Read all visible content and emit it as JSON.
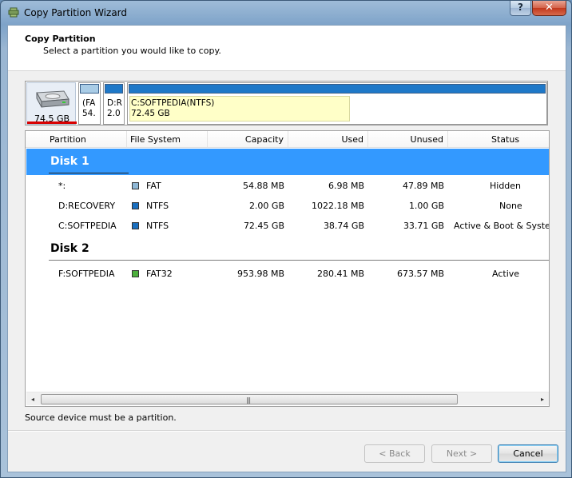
{
  "window": {
    "title": "Copy Partition Wizard",
    "close_glyph": "✕",
    "help_glyph": "?"
  },
  "header": {
    "title": "Copy Partition",
    "subtitle": "Select a partition you would like to copy."
  },
  "disk_map": {
    "disk_size": "74.5 GB",
    "blocks": [
      {
        "line1": "(FA",
        "line2": "54.",
        "bar_color": "#a9cce6"
      },
      {
        "line1": "D:R",
        "line2": "2.0",
        "bar_color": "#1e78c8"
      },
      {
        "line1": "C:SOFTPEDIA(NTFS)",
        "line2": "72.45 GB",
        "bar_color": "#1e78c8"
      }
    ]
  },
  "list": {
    "columns": [
      "Partition",
      "File System",
      "Capacity",
      "Used",
      "Unused",
      "Status"
    ],
    "disks": [
      {
        "label": "Disk 1",
        "partitions": [
          {
            "partition": "*:",
            "fs": "FAT",
            "fs_color": "#8fb8d6",
            "capacity": "54.88 MB",
            "used": "6.98 MB",
            "unused": "47.89 MB",
            "status": "Hidden"
          },
          {
            "partition": "D:RECOVERY",
            "fs": "NTFS",
            "fs_color": "#1a6fbf",
            "capacity": "2.00 GB",
            "used": "1022.18 MB",
            "unused": "1.00 GB",
            "status": "None"
          },
          {
            "partition": "C:SOFTPEDIA",
            "fs": "NTFS",
            "fs_color": "#1a6fbf",
            "capacity": "72.45 GB",
            "used": "38.74 GB",
            "unused": "33.71 GB",
            "status": "Active & Boot & System"
          }
        ]
      },
      {
        "label": "Disk 2",
        "partitions": [
          {
            "partition": "F:SOFTPEDIA",
            "fs": "FAT32",
            "fs_color": "#4caf3c",
            "capacity": "953.98 MB",
            "used": "280.41 MB",
            "unused": "673.57 MB",
            "status": "Active"
          }
        ]
      }
    ],
    "scroll": {
      "left_glyph": "◂",
      "right_glyph": "▸",
      "grip_glyph": "|||"
    }
  },
  "status_text": "Source device must be a partition.",
  "buttons": {
    "back": "< Back",
    "next": "Next >",
    "cancel": "Cancel"
  }
}
